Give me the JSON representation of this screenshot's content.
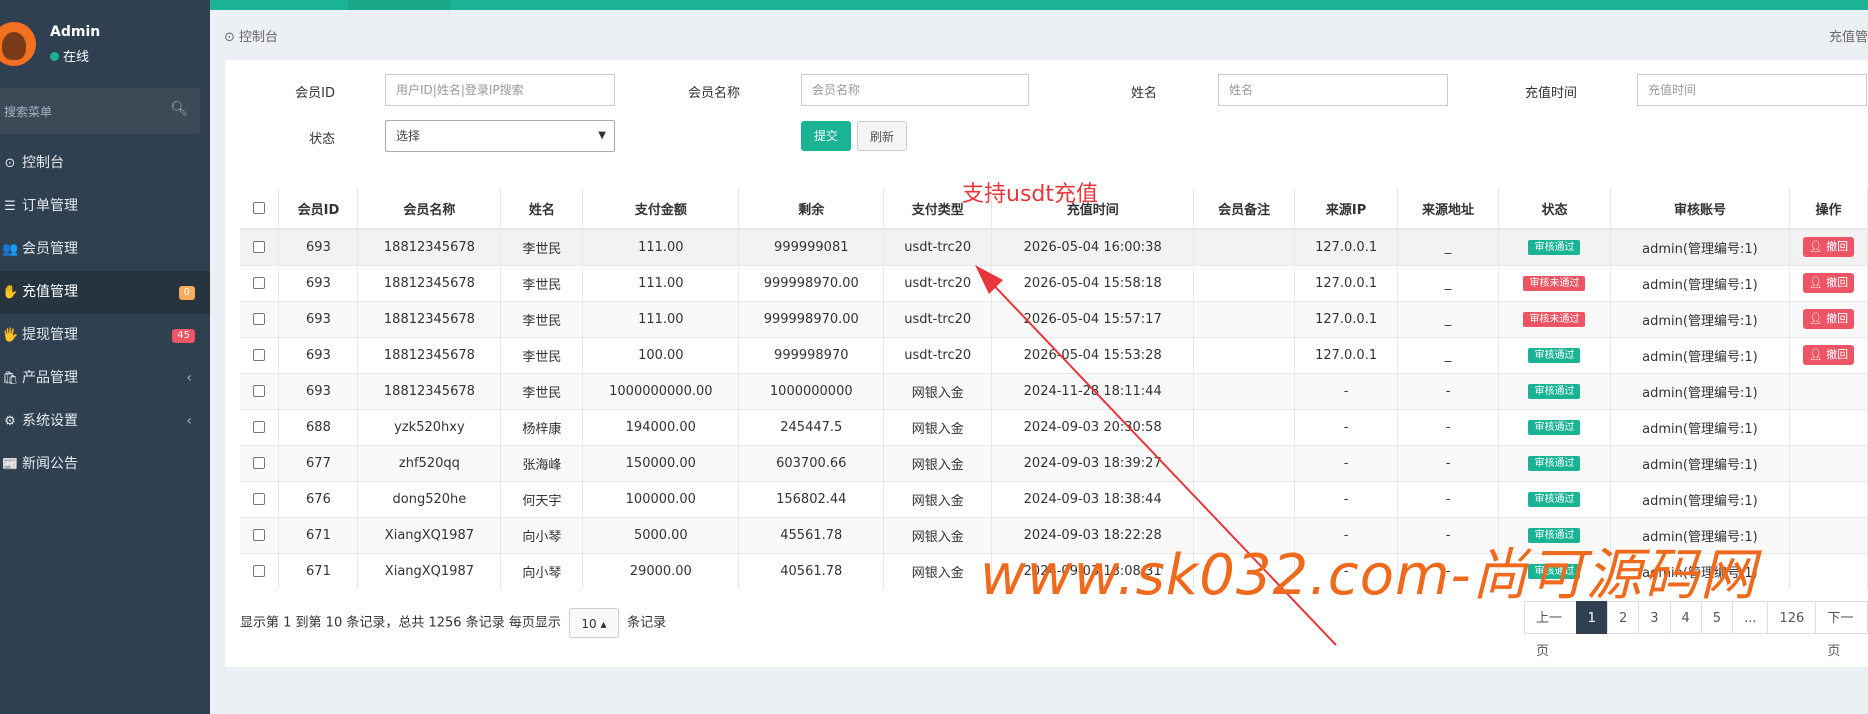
{
  "sidebar": {
    "user_name": "Admin",
    "user_status": "在线",
    "search_placeholder": "搜索菜单",
    "items": [
      {
        "icon": "⊙",
        "label": "控制台"
      },
      {
        "icon": "☰",
        "label": "订单管理"
      },
      {
        "icon": "👥",
        "label": "会员管理"
      },
      {
        "icon": "✋",
        "label": "充值管理",
        "badge": "0"
      },
      {
        "icon": "🖐",
        "label": "提现管理",
        "badge": "45"
      },
      {
        "icon": "🛍",
        "label": "产品管理",
        "arrow": "‹"
      },
      {
        "icon": "⚙",
        "label": "系统设置",
        "arrow": "‹"
      },
      {
        "icon": "📰",
        "label": "新闻公告"
      }
    ]
  },
  "header": {
    "breadcrumb": "控制台",
    "right_text": "充值管"
  },
  "filters": {
    "member_id_label": "会员ID",
    "member_id_placeholder": "用户ID|姓名|登录IP搜索",
    "member_name_label": "会员名称",
    "member_name_placeholder": "会员名称",
    "real_name_label": "姓名",
    "real_name_placeholder": "姓名",
    "recharge_time_label": "充值时间",
    "recharge_time_placeholder": "充值时间",
    "status_label": "状态",
    "status_value": "选择",
    "submit_label": "提交",
    "refresh_label": "刷新"
  },
  "table": {
    "headers": [
      "会员ID",
      "会员名称",
      "姓名",
      "支付金额",
      "剩余",
      "支付类型",
      "充值时间",
      "会员备注",
      "来源IP",
      "来源地址",
      "状态",
      "审核账号",
      "操作"
    ],
    "rows": [
      {
        "id": "693",
        "name": "18812345678",
        "real": "李世民",
        "amount": "111.00",
        "remain": "999999081",
        "type": "usdt-trc20",
        "time": "2026-05-04 16:00:38",
        "note": "",
        "ip": "127.0.0.1",
        "addr": "_",
        "status": "审核通过",
        "status_ok": true,
        "auditor": "admin(管理编号:1)",
        "action": "撤回"
      },
      {
        "id": "693",
        "name": "18812345678",
        "real": "李世民",
        "amount": "111.00",
        "remain": "999998970.00",
        "type": "usdt-trc20",
        "time": "2026-05-04 15:58:18",
        "note": "",
        "ip": "127.0.0.1",
        "addr": "_",
        "status": "审核未通过",
        "status_ok": false,
        "auditor": "admin(管理编号:1)",
        "action": "撤回"
      },
      {
        "id": "693",
        "name": "18812345678",
        "real": "李世民",
        "amount": "111.00",
        "remain": "999998970.00",
        "type": "usdt-trc20",
        "time": "2026-05-04 15:57:17",
        "note": "",
        "ip": "127.0.0.1",
        "addr": "_",
        "status": "审核未通过",
        "status_ok": false,
        "auditor": "admin(管理编号:1)",
        "action": "撤回"
      },
      {
        "id": "693",
        "name": "18812345678",
        "real": "李世民",
        "amount": "100.00",
        "remain": "999998970",
        "type": "usdt-trc20",
        "time": "2026-05-04 15:53:28",
        "note": "",
        "ip": "127.0.0.1",
        "addr": "_",
        "status": "审核通过",
        "status_ok": true,
        "auditor": "admin(管理编号:1)",
        "action": "撤回"
      },
      {
        "id": "693",
        "name": "18812345678",
        "real": "李世民",
        "amount": "1000000000.00",
        "remain": "1000000000",
        "type": "网银入金",
        "time": "2024-11-28 18:11:44",
        "note": "",
        "ip": "-",
        "addr": "-",
        "status": "审核通过",
        "status_ok": true,
        "auditor": "admin(管理编号:1)",
        "action": ""
      },
      {
        "id": "688",
        "name": "yzk520hxy",
        "real": "杨梓康",
        "amount": "194000.00",
        "remain": "245447.5",
        "type": "网银入金",
        "time": "2024-09-03 20:30:58",
        "note": "",
        "ip": "-",
        "addr": "-",
        "status": "审核通过",
        "status_ok": true,
        "auditor": "admin(管理编号:1)",
        "action": ""
      },
      {
        "id": "677",
        "name": "zhf520qq",
        "real": "张海峰",
        "amount": "150000.00",
        "remain": "603700.66",
        "type": "网银入金",
        "time": "2024-09-03 18:39:27",
        "note": "",
        "ip": "-",
        "addr": "-",
        "status": "审核通过",
        "status_ok": true,
        "auditor": "admin(管理编号:1)",
        "action": ""
      },
      {
        "id": "676",
        "name": "dong520he",
        "real": "何天宇",
        "amount": "100000.00",
        "remain": "156802.44",
        "type": "网银入金",
        "time": "2024-09-03 18:38:44",
        "note": "",
        "ip": "-",
        "addr": "-",
        "status": "审核通过",
        "status_ok": true,
        "auditor": "admin(管理编号:1)",
        "action": ""
      },
      {
        "id": "671",
        "name": "XiangXQ1987",
        "real": "向小琴",
        "amount": "5000.00",
        "remain": "45561.78",
        "type": "网银入金",
        "time": "2024-09-03 18:22:28",
        "note": "",
        "ip": "-",
        "addr": "-",
        "status": "审核通过",
        "status_ok": true,
        "auditor": "admin(管理编号:1)",
        "action": ""
      },
      {
        "id": "671",
        "name": "XiangXQ1987",
        "real": "向小琴",
        "amount": "29000.00",
        "remain": "40561.78",
        "type": "网银入金",
        "time": "2024-09-03 18:08:31",
        "note": "",
        "ip": "-",
        "addr": "-",
        "status": "审核通过",
        "status_ok": true,
        "auditor": "admin(管理编号:1)",
        "action": ""
      }
    ]
  },
  "footer": {
    "info_prefix": "显示第 1 到第 10 条记录，总共 1256 条记录 每页显示",
    "page_size": "10 ▴",
    "info_suffix": "条记录",
    "pages": [
      "上一页",
      "1",
      "2",
      "3",
      "4",
      "5",
      "...",
      "126",
      "下一页"
    ],
    "current_page": "1"
  },
  "annotation": {
    "note": "支持usdt充值",
    "watermark": "www.sk032.com-尚可源码网"
  },
  "colors": {
    "accent": "#1ab394",
    "sidebar": "#2f4050",
    "danger": "#ed5565",
    "warning": "#f8ac59",
    "annotation": "#e8373c",
    "watermark": "#f06a1d"
  }
}
